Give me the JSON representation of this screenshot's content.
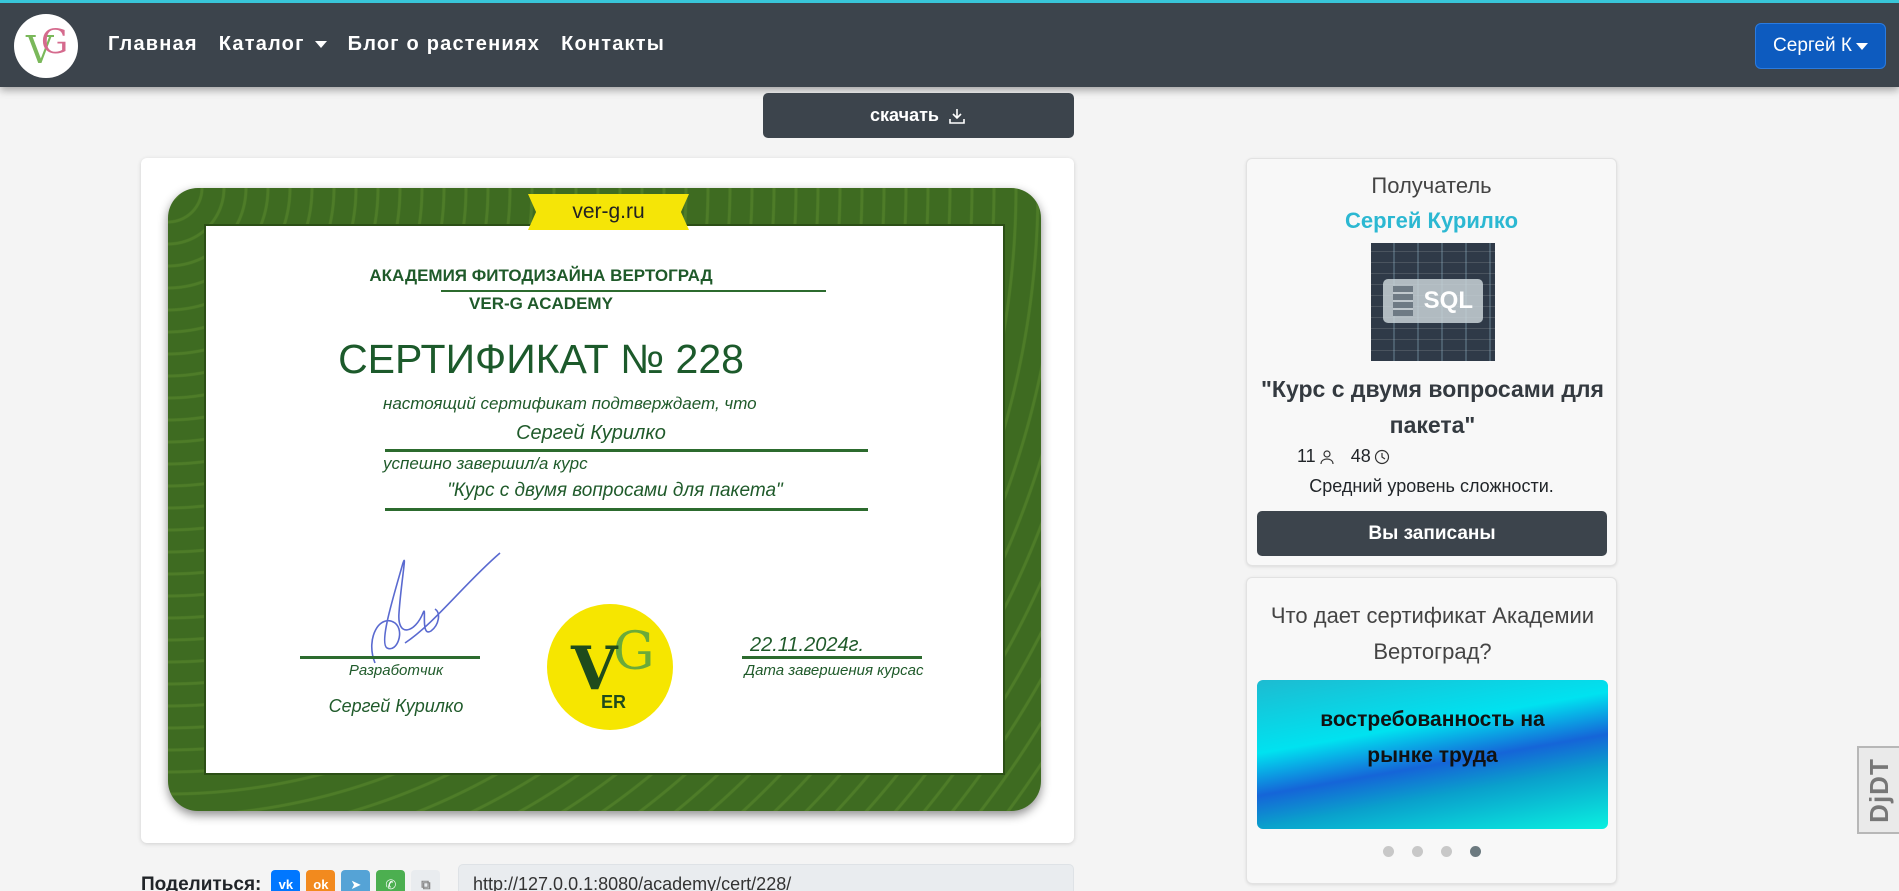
{
  "navbar": {
    "logo_text_v": "V",
    "logo_text_g": "G",
    "links": [
      {
        "label": "Главная"
      },
      {
        "label": "Каталог"
      },
      {
        "label": "Блог о растениях"
      },
      {
        "label": "Контакты"
      }
    ],
    "user_label": "Сергей К",
    "accent_color": "#38c6d9",
    "bg_color": "#3c444c"
  },
  "download": {
    "label": "скачать",
    "icon": "download-icon"
  },
  "certificate": {
    "ribbon": "ver-g.ru",
    "academy_ru": "АКАДЕМИЯ ФИТОДИЗАЙНА ВЕРТОГРАД",
    "academy_en": "VER-G ACADEMY",
    "title": "СЕРТИФИКАТ № 228",
    "confirms": "настоящий сертификат подтверждает, что",
    "recipient": "Сергей Курилко",
    "completed": "успешно завершил/а курс",
    "course": "\"Курс с двумя вопросами для пакета\"",
    "developer_label": "Разработчик",
    "developer_name": "Сергей Курилко",
    "seal_v": "V",
    "seal_g": "G",
    "seal_er": "ER",
    "date": "22.11.2024г.",
    "date_label": "Дата завершения курсас"
  },
  "share": {
    "label": "Поделиться:",
    "networks": [
      {
        "name": "vk",
        "glyph": "vk"
      },
      {
        "name": "ok",
        "glyph": "ok"
      },
      {
        "name": "telegram",
        "glyph": "➤"
      },
      {
        "name": "whatsapp",
        "glyph": "✆"
      },
      {
        "name": "copy",
        "glyph": "⧉"
      }
    ],
    "url": "http://127.0.0.1:8080/academy/cert/228/"
  },
  "recipient_card": {
    "title": "Получатель",
    "name": "Сергей Курилко",
    "thumb_label": "SQL",
    "course_name": "\"Курс с двумя вопросами для пакета\"",
    "students": "11",
    "hours": "48",
    "level": "Средний уровень сложности.",
    "enrolled_label": "Вы записаны"
  },
  "benefit_card": {
    "title": "Что дает сертификат Академии Вертоград?",
    "slide_text": "востребованность на рынке труда",
    "slide_count": 4,
    "active_slide": 4
  },
  "djdt": {
    "label": "DjDT"
  }
}
